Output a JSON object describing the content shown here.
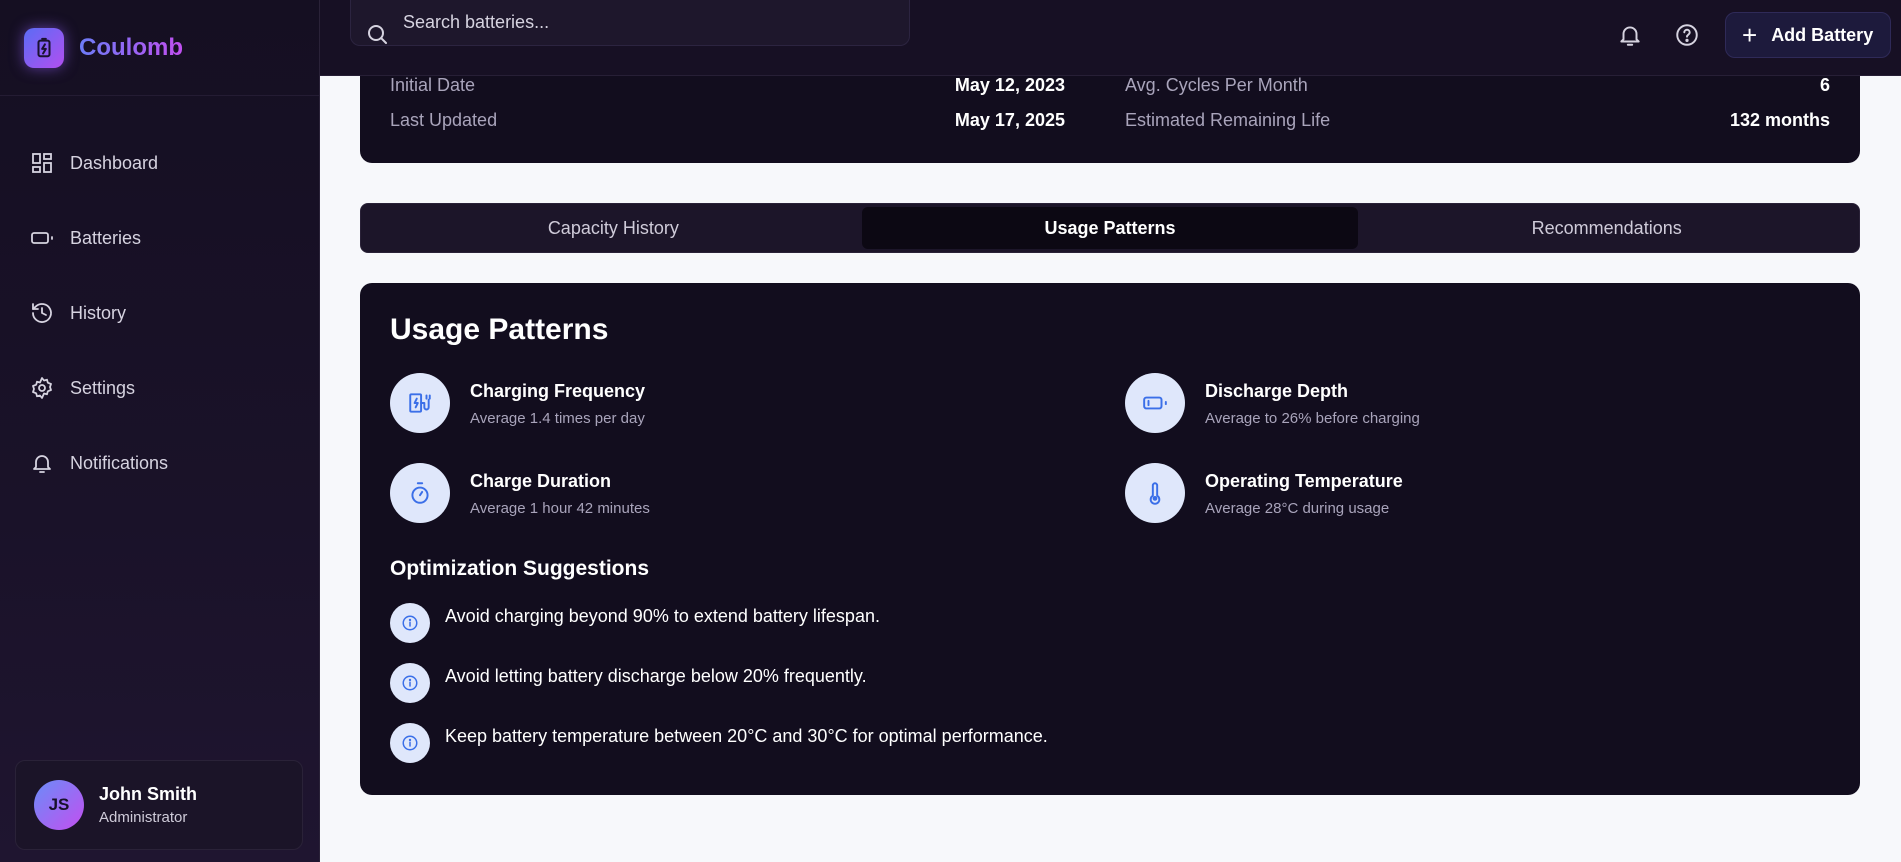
{
  "brand": {
    "name": "Coulomb",
    "logo_icon": "battery-charging-icon"
  },
  "nav": {
    "items": [
      {
        "label": "Dashboard",
        "icon": "dashboard-icon"
      },
      {
        "label": "Batteries",
        "icon": "battery-icon"
      },
      {
        "label": "History",
        "icon": "history-icon"
      },
      {
        "label": "Settings",
        "icon": "gear-icon"
      },
      {
        "label": "Notifications",
        "icon": "bell-icon"
      }
    ]
  },
  "user": {
    "initials": "JS",
    "name": "John Smith",
    "role": "Administrator"
  },
  "header": {
    "search_placeholder": "Search batteries...",
    "add_button_label": "Add Battery"
  },
  "info": {
    "initial_date_label": "Initial Date",
    "initial_date_value": "May 12, 2023",
    "last_updated_label": "Last Updated",
    "last_updated_value": "May 17, 2025",
    "avg_cycles_label": "Avg. Cycles Per Month",
    "avg_cycles_value": "6",
    "remaining_life_label": "Estimated Remaining Life",
    "remaining_life_value": "132 months"
  },
  "tabs": [
    {
      "label": "Capacity History",
      "active": false
    },
    {
      "label": "Usage Patterns",
      "active": true
    },
    {
      "label": "Recommendations",
      "active": false
    }
  ],
  "usage": {
    "title": "Usage Patterns",
    "metrics": [
      {
        "title": "Charging Frequency",
        "desc": "Average 1.4 times per day",
        "icon": "charging-station-icon"
      },
      {
        "title": "Discharge Depth",
        "desc": "Average to 26% before charging",
        "icon": "battery-low-icon"
      },
      {
        "title": "Charge Duration",
        "desc": "Average 1 hour 42 minutes",
        "icon": "timer-icon"
      },
      {
        "title": "Operating Temperature",
        "desc": "Average 28°C during usage",
        "icon": "thermometer-icon"
      }
    ],
    "optimization_title": "Optimization Suggestions",
    "suggestions": [
      "Avoid charging beyond 90% to extend battery lifespan.",
      "Avoid letting battery discharge below 20% frequently.",
      "Keep battery temperature between 20°C and 30°C for optimal performance."
    ]
  },
  "colors": {
    "sidebar_bg": "#150f22",
    "card_bg": "#120d1e",
    "accent_gradient_start": "#5b6cf5",
    "accent_gradient_end": "#c14ff0",
    "icon_circle_bg": "#dfe7fb",
    "icon_blue": "#3b6fe8",
    "page_bg": "#f7f8fb"
  }
}
